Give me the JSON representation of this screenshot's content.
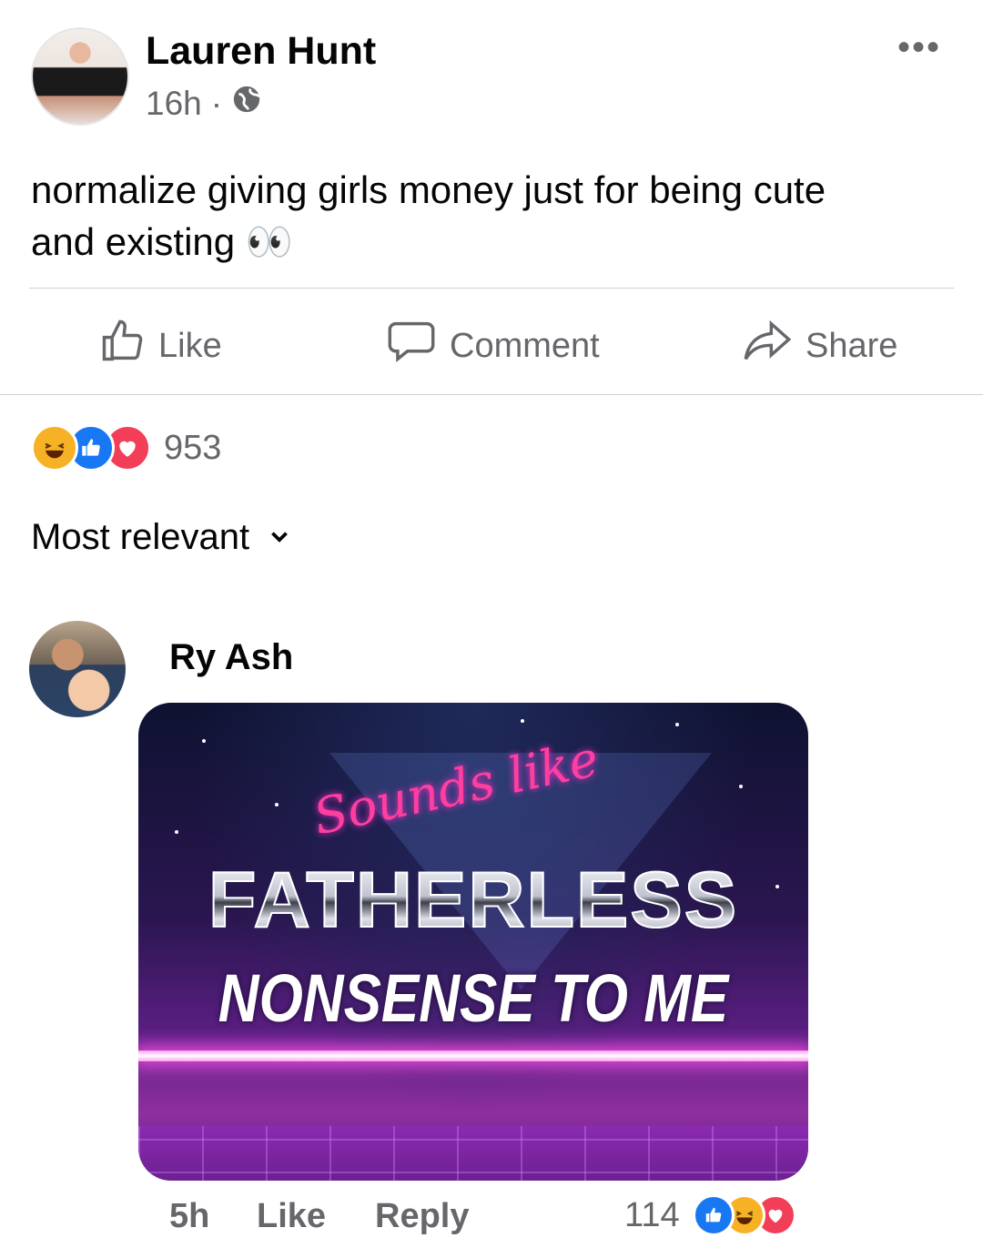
{
  "post": {
    "author": "Lauren Hunt",
    "time": "16h",
    "separator": "·",
    "text_line1": "normalize giving girls money just for being cute",
    "text_line2": "and existing",
    "emoji": "👀",
    "more_icon": "more-horizontal-icon",
    "privacy_icon": "globe-icon"
  },
  "actions": {
    "like": "Like",
    "comment": "Comment",
    "share": "Share"
  },
  "reactions": {
    "count": "953",
    "types": [
      "haha",
      "like",
      "love"
    ]
  },
  "sort": {
    "label": "Most relevant"
  },
  "comment": {
    "author": "Ry Ash",
    "meme": {
      "line1": "Sounds like",
      "line2": "FATHERLESS",
      "line3": "NONSENSE TO ME"
    },
    "time": "5h",
    "like": "Like",
    "reply": "Reply",
    "reaction_count": "114",
    "reaction_types": [
      "like",
      "haha",
      "love"
    ]
  },
  "colors": {
    "secondary_text": "#65676b",
    "like_blue": "#1877f2",
    "love_red": "#f33e58",
    "haha_yellow": "#f7b125"
  }
}
